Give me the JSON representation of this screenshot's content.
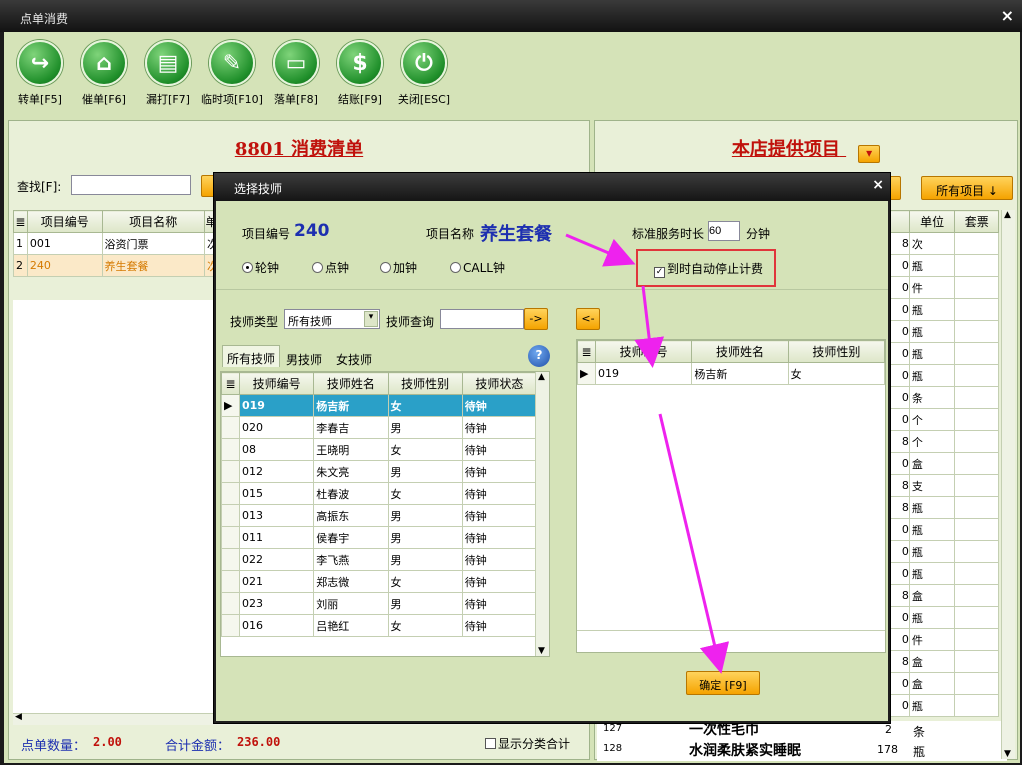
{
  "window": {
    "title": "点单消费",
    "close": "×"
  },
  "toolbar": [
    {
      "label": "转单[F5]",
      "icon": "↪"
    },
    {
      "label": "催单[F6]",
      "icon": "⌂"
    },
    {
      "label": "漏打[F7]",
      "icon": "▤"
    },
    {
      "label": "临时项[F10]",
      "icon": "✎"
    },
    {
      "label": "落单[F8]",
      "icon": "▭"
    },
    {
      "label": "结账[F9]",
      "icon": "$"
    },
    {
      "label": "关闭[ESC]",
      "icon": "⏻"
    }
  ],
  "left": {
    "title": "8801  消费清单",
    "search_label": "查找[F]:",
    "search_value": "",
    "headers": [
      "项目编号",
      "项目名称",
      "单"
    ],
    "rows": [
      {
        "n": "1",
        "code": "001",
        "name": "浴资门票",
        "unit": "次"
      },
      {
        "n": "2",
        "code": "240",
        "name": "养生套餐",
        "unit": "次"
      }
    ],
    "count_label": "点单数量：",
    "count": "2.00",
    "total_label": "合计金额：",
    "total": "236.00",
    "show_category": "显示分类合计"
  },
  "right": {
    "title": "本店提供项目",
    "all_items": "所有项目 ↓",
    "headers": [
      "单位",
      "套票"
    ],
    "rows": [
      {
        "v": "8",
        "u": "次"
      },
      {
        "v": "0",
        "u": "瓶"
      },
      {
        "v": "0",
        "u": "件"
      },
      {
        "v": "0",
        "u": "瓶"
      },
      {
        "v": "0",
        "u": "瓶"
      },
      {
        "v": "0",
        "u": "瓶"
      },
      {
        "v": "0",
        "u": "瓶"
      },
      {
        "v": "0",
        "u": "条"
      },
      {
        "v": "0",
        "u": "个"
      },
      {
        "v": "8",
        "u": "个"
      },
      {
        "v": "0",
        "u": "盒"
      },
      {
        "v": "8",
        "u": "支"
      },
      {
        "v": "8",
        "u": "瓶"
      },
      {
        "v": "0",
        "u": "瓶"
      },
      {
        "v": "0",
        "u": "瓶"
      },
      {
        "v": "0",
        "u": "瓶"
      },
      {
        "v": "8",
        "u": "盒"
      },
      {
        "v": "0",
        "u": "瓶"
      },
      {
        "v": "0",
        "u": "件"
      },
      {
        "v": "8",
        "u": "盒"
      },
      {
        "v": "0",
        "u": "盒"
      },
      {
        "v": "0",
        "u": "瓶"
      }
    ],
    "bottom_rows": [
      {
        "code": "127",
        "name": "一次性毛巾",
        "price": "2",
        "unit": "条"
      },
      {
        "code": "128",
        "name": "水润柔肤紧实睡眠",
        "price": "178",
        "unit": "瓶"
      }
    ]
  },
  "dialog": {
    "title": "选择技师",
    "close": "×",
    "item_code_label": "项目编号",
    "item_code": "240",
    "item_name_label": "项目名称",
    "item_name": "养生套餐",
    "duration_label": "标准服务时长",
    "duration": "60",
    "duration_unit": "分钟",
    "radios": [
      "轮钟",
      "点钟",
      "加钟",
      "CALL钟"
    ],
    "auto_stop": "到时自动停止计费",
    "tech_type_label": "技师类型",
    "tech_type": "所有技师",
    "tech_search_label": "技师查询",
    "tech_search": "",
    "tabs": [
      "所有技师",
      "男技师",
      "女技师"
    ],
    "left_headers": [
      "技师编号",
      "技师姓名",
      "技师性别",
      "技师状态"
    ],
    "techs": [
      [
        "019",
        "杨吉新",
        "女",
        "待钟"
      ],
      [
        "020",
        "李春吉",
        "男",
        "待钟"
      ],
      [
        "08",
        "王晓明",
        "女",
        "待钟"
      ],
      [
        "012",
        "朱文亮",
        "男",
        "待钟"
      ],
      [
        "015",
        "杜春波",
        "女",
        "待钟"
      ],
      [
        "013",
        "高振东",
        "男",
        "待钟"
      ],
      [
        "011",
        "侯春宇",
        "男",
        "待钟"
      ],
      [
        "022",
        "李飞燕",
        "男",
        "待钟"
      ],
      [
        "021",
        "郑志微",
        "女",
        "待钟"
      ],
      [
        "023",
        "刘丽",
        "男",
        "待钟"
      ],
      [
        "016",
        "吕艳红",
        "女",
        "待钟"
      ]
    ],
    "right_headers": [
      "技师编号",
      "技师姓名",
      "技师性别"
    ],
    "selected": [
      [
        "019",
        "杨吉新",
        "女"
      ]
    ],
    "go_button": "->",
    "back_button": "<-",
    "confirm": "确定 [F9]"
  },
  "colors": {
    "accent_red": "#c0110b",
    "selection": "#2aa0c8",
    "annotation": "#ee22ee"
  }
}
